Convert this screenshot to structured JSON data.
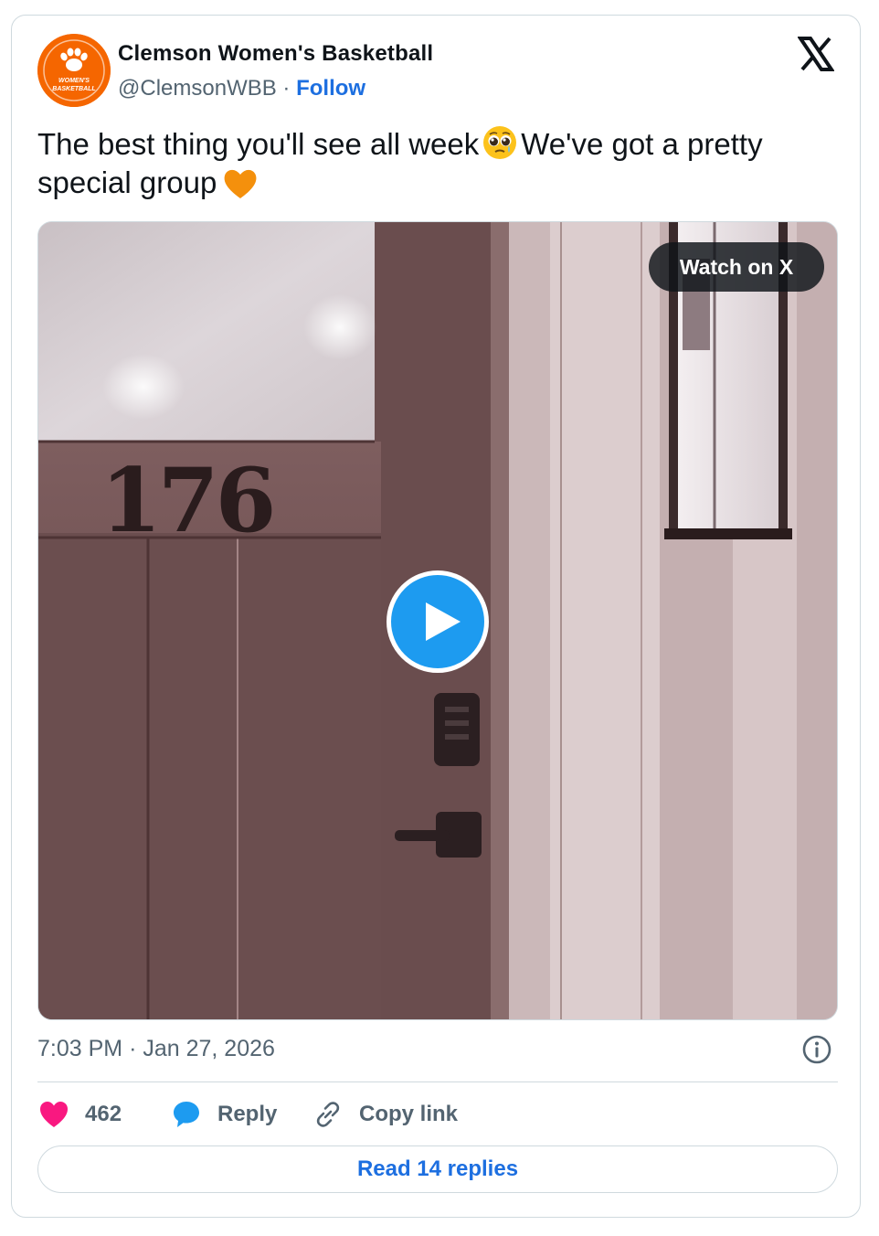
{
  "author": {
    "name": "Clemson Women's Basketball",
    "handle": "@ClemsonWBB",
    "separator": "·",
    "follow_label": "Follow",
    "avatar_text": "WOMEN'S BASKETBALL",
    "brand_color": "#f56600"
  },
  "tweet": {
    "text_part1": "The best thing you'll see all week",
    "text_part2": "We've got a pretty special group",
    "emoji_1": "pleading-face-with-tear",
    "emoji_2": "orange-heart"
  },
  "media": {
    "watch_label": "Watch on X",
    "door_number": "176"
  },
  "meta": {
    "time": "7:03 PM",
    "separator": "·",
    "date": "Jan 27, 2026"
  },
  "actions": {
    "likes_count": "462",
    "reply_label": "Reply",
    "copy_label": "Copy link",
    "read_replies_label": "Read 14 replies"
  },
  "colors": {
    "accent_blue": "#1d9bf0",
    "link_blue": "#1d6fe0",
    "like_pink": "#f91880",
    "muted_text": "#536471"
  }
}
